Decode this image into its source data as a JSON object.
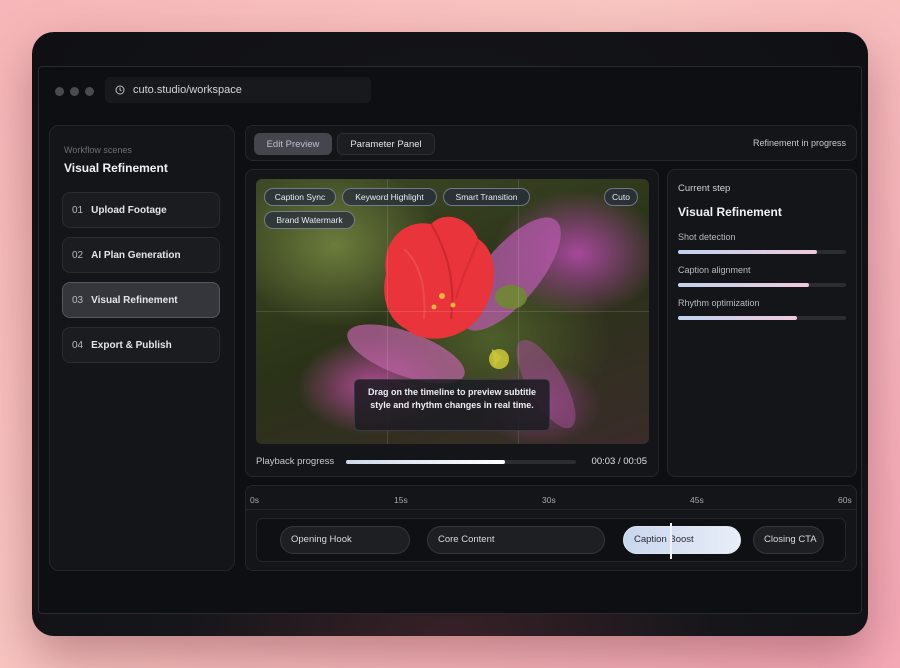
{
  "browser": {
    "url": "cuto.studio/workspace"
  },
  "sidebar": {
    "caption": "Workflow scenes",
    "title": "Visual Refinement",
    "scenes": [
      {
        "num": "01",
        "label": "Upload Footage",
        "active": false
      },
      {
        "num": "02",
        "label": "AI Plan Generation",
        "active": false
      },
      {
        "num": "03",
        "label": "Visual Refinement",
        "active": true
      },
      {
        "num": "04",
        "label": "Export & Publish",
        "active": false
      }
    ]
  },
  "toolbar": {
    "edit_preview": "Edit Preview",
    "parameter_panel": "Parameter Panel",
    "status": "Refinement in progress"
  },
  "preview": {
    "chips": [
      "Caption Sync",
      "Keyword Highlight",
      "Smart Transition",
      "Brand Watermark"
    ],
    "brand": "Cuto",
    "tooltip": "Drag on the timeline to preview subtitle style and rhythm changes in real time.",
    "playback_label": "Playback progress",
    "playback_progress": 0.69,
    "playback_time": "00:03 / 00:05"
  },
  "steps": {
    "caption": "Current step",
    "title": "Visual Refinement",
    "metrics": [
      {
        "label": "Shot detection",
        "value": 0.83
      },
      {
        "label": "Caption alignment",
        "value": 0.78
      },
      {
        "label": "Rhythm optimization",
        "value": 0.71
      }
    ]
  },
  "timeline": {
    "ticks": [
      "0s",
      "15s",
      "30s",
      "45s",
      "60s"
    ],
    "clips": [
      {
        "label": "Opening Hook",
        "active": false
      },
      {
        "label": "Core Content",
        "active": false
      },
      {
        "label": "Caption Boost",
        "active": true
      },
      {
        "label": "Closing CTA",
        "active": false
      }
    ]
  },
  "colors": {
    "accent": "#cfd8ea",
    "flower": "#e8343a"
  }
}
